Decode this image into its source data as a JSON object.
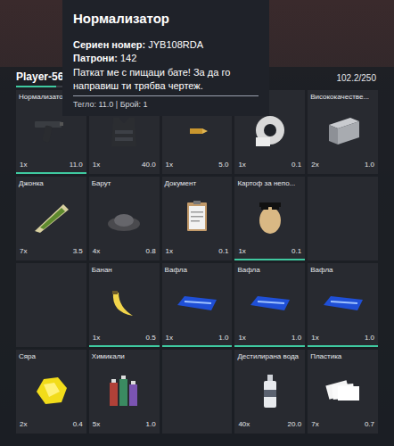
{
  "player": {
    "name": "Player-56",
    "weight": "102.2/250",
    "level": 0.41
  },
  "tooltip": {
    "title": "Нормализатор",
    "lines": [
      {
        "label": "Сериен номер:",
        "value": "JYB108RDA"
      },
      {
        "label": "Патрони:",
        "value": "142"
      }
    ],
    "description": "Паткат ме с пищаци бате! За да го направиш ти трябва чертеж.",
    "footer": "Тегло: 11.0 | Брой: 1"
  },
  "slots": [
    {
      "kind": "pistol",
      "label": "Нормализато",
      "count": "1x",
      "weight": "11.0",
      "durability": 1
    },
    {
      "kind": "vest",
      "count": "1x",
      "weight": "40.0"
    },
    {
      "kind": "ammo",
      "count": "1x",
      "weight": "5.0"
    },
    {
      "kind": "tape",
      "label": "Тиксо",
      "count": "1x",
      "weight": "0.1"
    },
    {
      "kind": "metal",
      "label": "Висококачестве...",
      "count": "2x",
      "weight": "1.0"
    },
    {
      "kind": "joint",
      "label": "Джонка",
      "count": "7x",
      "weight": "3.5"
    },
    {
      "kind": "powder",
      "label": "Барут",
      "count": "4x",
      "weight": "0.8"
    },
    {
      "kind": "document",
      "label": "Документ",
      "count": "1x",
      "weight": "0.1"
    },
    {
      "kind": "potato",
      "label": "Картоф за непо...",
      "count": "1x",
      "weight": "0.1",
      "durability": 1
    },
    {
      "kind": "empty"
    },
    {
      "kind": "empty"
    },
    {
      "kind": "banana",
      "label": "Банан",
      "count": "1x",
      "weight": "0.5",
      "durability": 1
    },
    {
      "kind": "waffle",
      "label": "Вафла",
      "count": "1x",
      "weight": "1.0",
      "durability": 1
    },
    {
      "kind": "waffle",
      "label": "Вафла",
      "count": "1x",
      "weight": "1.0",
      "durability": 1
    },
    {
      "kind": "waffle",
      "label": "Вафла",
      "count": "1x",
      "weight": "1.0",
      "durability": 1
    },
    {
      "kind": "sulfur",
      "label": "Сяра",
      "count": "2x",
      "weight": "0.4"
    },
    {
      "kind": "chemicals",
      "label": "Химикали",
      "count": "5x",
      "weight": "1.0"
    },
    {
      "kind": "empty"
    },
    {
      "kind": "water",
      "label": "Дестилирана вода",
      "count": "40x",
      "weight": "20.0"
    },
    {
      "kind": "plastic",
      "label": "Пластика",
      "count": "7x",
      "weight": "0.7"
    }
  ]
}
